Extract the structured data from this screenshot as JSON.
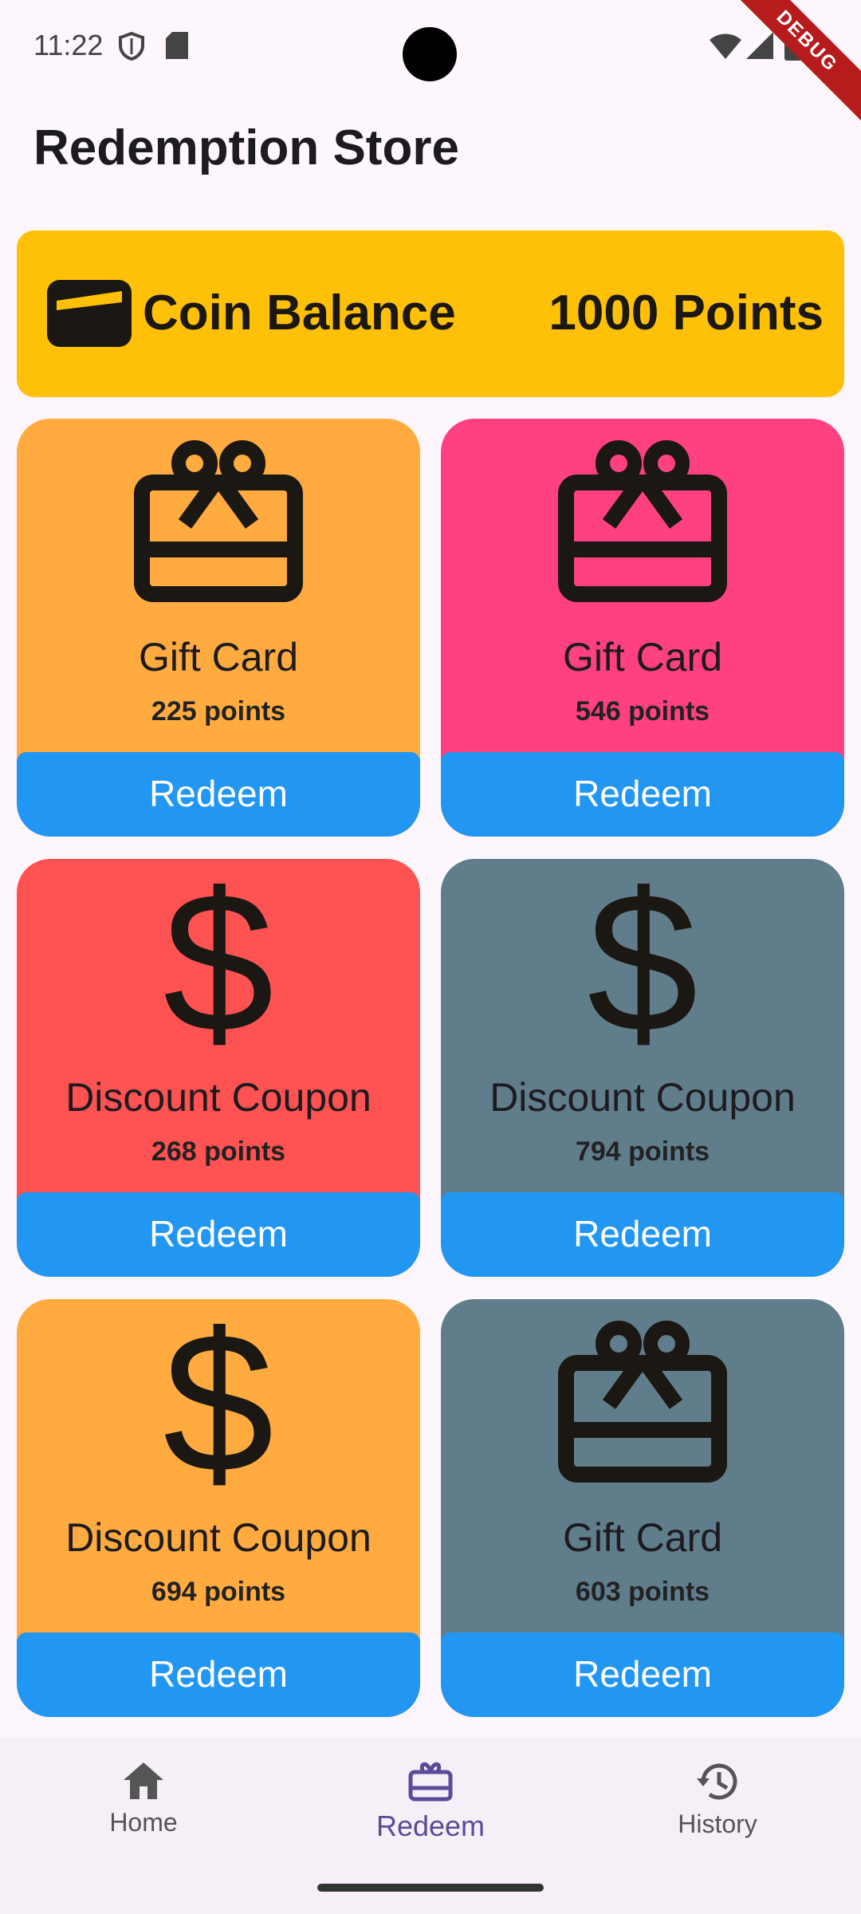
{
  "status": {
    "time": "11:22"
  },
  "debug_label": "DEBUG",
  "header": {
    "title": "Redemption Store"
  },
  "balance": {
    "label": "Coin Balance",
    "value": "1000 Points",
    "color": "#ffc107"
  },
  "items": [
    {
      "title": "Gift Card",
      "points": "225 points",
      "icon": "gift-card-icon",
      "color": "#ffab40",
      "button": "Redeem"
    },
    {
      "title": "Gift Card",
      "points": "546 points",
      "icon": "gift-card-icon",
      "color": "#ff4081",
      "button": "Redeem"
    },
    {
      "title": "Discount Coupon",
      "points": "268 points",
      "icon": "dollar-icon",
      "color": "#ff5252",
      "button": "Redeem"
    },
    {
      "title": "Discount Coupon",
      "points": "794 points",
      "icon": "dollar-icon",
      "color": "#607d8b",
      "button": "Redeem"
    },
    {
      "title": "Discount Coupon",
      "points": "694 points",
      "icon": "dollar-icon",
      "color": "#ffab40",
      "button": "Redeem"
    },
    {
      "title": "Gift Card",
      "points": "603 points",
      "icon": "gift-card-icon",
      "color": "#607d8b",
      "button": "Redeem"
    }
  ],
  "button_color": "#2196f3",
  "nav": {
    "items": [
      {
        "label": "Home",
        "icon": "home-icon",
        "active": false
      },
      {
        "label": "Redeem",
        "icon": "redeem-icon",
        "active": true
      },
      {
        "label": "History",
        "icon": "history-icon",
        "active": false
      }
    ],
    "active_color": "#5a4b9a"
  }
}
